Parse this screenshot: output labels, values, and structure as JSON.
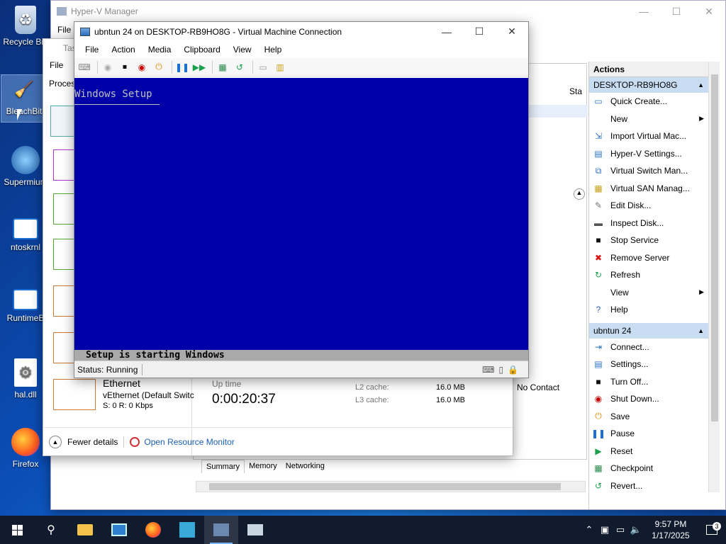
{
  "desktop": {
    "icons": [
      {
        "label": "Recycle Bin",
        "icon": "recycle-bin-icon"
      },
      {
        "label": "BleachBit",
        "icon": "broom-icon"
      },
      {
        "label": "Supermium",
        "icon": "browser-icon"
      },
      {
        "label": "ntoskrnl",
        "icon": "file-icon"
      },
      {
        "label": "RuntimeB",
        "icon": "file-icon"
      },
      {
        "label": "hal.dll",
        "icon": "gear-file-icon"
      },
      {
        "label": "Firefox",
        "icon": "firefox-icon"
      }
    ]
  },
  "hyperv": {
    "title": "Hyper-V Manager",
    "menu_file": "File",
    "status_col": "Sta",
    "no_contact": "No Contact",
    "tabs": [
      "Summary",
      "Memory",
      "Networking"
    ],
    "actions_header": "Actions",
    "groups": [
      {
        "title": "DESKTOP-RB9HO8G",
        "items": [
          {
            "label": "Quick Create...",
            "icon": "monitor-icon",
            "submenu": false
          },
          {
            "label": "New",
            "icon": "",
            "submenu": true
          },
          {
            "label": "Import Virtual Mac...",
            "icon": "import-icon",
            "submenu": false
          },
          {
            "label": "Hyper-V Settings...",
            "icon": "settings-icon",
            "submenu": false
          },
          {
            "label": "Virtual Switch Man...",
            "icon": "switch-icon",
            "submenu": false
          },
          {
            "label": "Virtual SAN Manag...",
            "icon": "san-icon",
            "submenu": false
          },
          {
            "label": "Edit Disk...",
            "icon": "edit-disk-icon",
            "submenu": false
          },
          {
            "label": "Inspect Disk...",
            "icon": "inspect-disk-icon",
            "submenu": false
          },
          {
            "label": "Stop Service",
            "icon": "stop-icon",
            "submenu": false
          },
          {
            "label": "Remove Server",
            "icon": "remove-icon",
            "submenu": false
          },
          {
            "label": "Refresh",
            "icon": "refresh-icon",
            "submenu": false
          },
          {
            "label": "View",
            "icon": "",
            "submenu": true
          },
          {
            "label": "Help",
            "icon": "help-icon",
            "submenu": false
          }
        ]
      },
      {
        "title": "ubntun 24",
        "items": [
          {
            "label": "Connect...",
            "icon": "connect-icon",
            "submenu": false
          },
          {
            "label": "Settings...",
            "icon": "settings-icon",
            "submenu": false
          },
          {
            "label": "Turn Off...",
            "icon": "turn-off-icon",
            "submenu": false
          },
          {
            "label": "Shut Down...",
            "icon": "shutdown-icon",
            "submenu": false
          },
          {
            "label": "Save",
            "icon": "save-icon",
            "submenu": false
          },
          {
            "label": "Pause",
            "icon": "pause-icon",
            "submenu": false
          },
          {
            "label": "Reset",
            "icon": "reset-icon",
            "submenu": false
          },
          {
            "label": "Checkpoint",
            "icon": "checkpoint-icon",
            "submenu": false
          },
          {
            "label": "Revert...",
            "icon": "revert-icon",
            "submenu": false
          }
        ]
      }
    ]
  },
  "taskmanager": {
    "title": "Tas",
    "menu_file": "File",
    "tab_processes": "Process",
    "ethernet": {
      "name": "Ethernet",
      "adapter": "vEthernet (Default Switc",
      "rate": "S: 0 R: 0 Kbps"
    },
    "uptime_label": "Up time",
    "uptime_value": "0:00:20:37",
    "cache": [
      {
        "label": "L2 cache:",
        "value": "16.0 MB"
      },
      {
        "label": "L3 cache:",
        "value": "16.0 MB"
      }
    ],
    "fewer_details": "Fewer details",
    "resource_monitor": "Open Resource Monitor"
  },
  "vm": {
    "title": "ubntun 24 on DESKTOP-RB9HO8G - Virtual Machine Connection",
    "menu": [
      "File",
      "Action",
      "Media",
      "Clipboard",
      "View",
      "Help"
    ],
    "screen_heading": "Windows Setup",
    "screen_status": "Setup is starting Windows",
    "status": "Status: Running"
  },
  "taskbar": {
    "time": "9:57 PM",
    "date": "1/17/2025",
    "notification_count": "3",
    "colors": {
      "bar": "#101b2e",
      "vm_screen": "#0000a8",
      "actions_group": "#c9ddf2"
    }
  }
}
